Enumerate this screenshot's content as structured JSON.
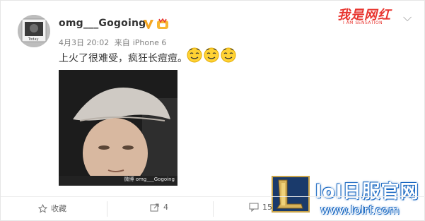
{
  "post": {
    "username": "omg___Gogoing",
    "date": "4月3日 20:02",
    "source_prefix": "来自",
    "source": "iPhone 6",
    "text": "上火了很难受，疯狂长痘痘。",
    "photo_watermark": "微博 omg___Gogoing"
  },
  "overlays": {
    "brand_top": "我是网红",
    "brand_top_sub": "I AM SENSATION",
    "lol_title": "lol日服官网",
    "lol_url": "www.lolrf.com"
  },
  "actions": {
    "favorite": "收藏",
    "forward_count": "4",
    "comment_count": "15"
  },
  "colors": {
    "brand_red": "#e8352f",
    "verified_gold": "#f5a623",
    "lol_blue": "#1565c0"
  },
  "icons": [
    "chevron-down-icon",
    "verified-icon",
    "vip-icon",
    "favorite-icon",
    "forward-icon",
    "comment-icon"
  ]
}
